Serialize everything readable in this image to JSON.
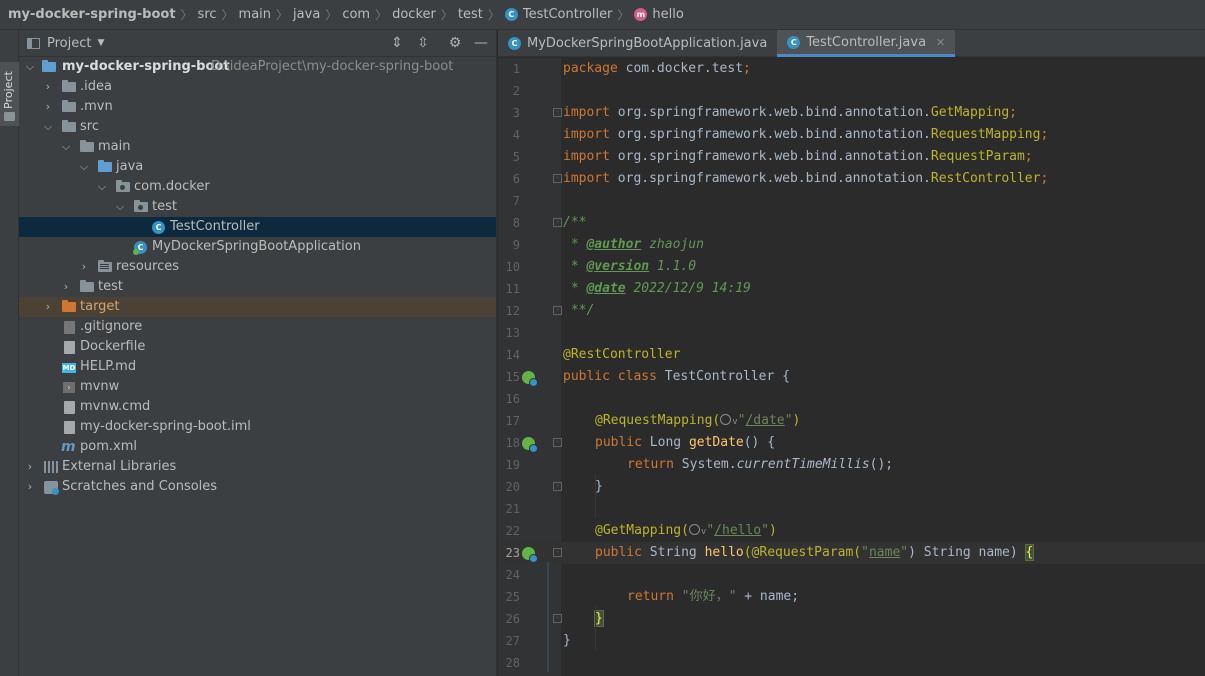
{
  "breadcrumbs": {
    "project": "my-docker-spring-boot",
    "path": [
      "src",
      "main",
      "java",
      "com",
      "docker",
      "test"
    ],
    "class_name": "TestController",
    "method_name": "hello"
  },
  "stripe": {
    "label": "Project"
  },
  "project_panel": {
    "title": "Project",
    "root_name": "my-docker-spring-boot",
    "root_path": "D:\\ideaProject\\my-docker-spring-boot",
    "tree": [
      {
        "label": ".idea"
      },
      {
        "label": ".mvn"
      },
      {
        "label": "src"
      },
      {
        "label": "main"
      },
      {
        "label": "java"
      },
      {
        "label": "com.docker"
      },
      {
        "label": "test"
      },
      {
        "label": "TestController"
      },
      {
        "label": "MyDockerSpringBootApplication"
      },
      {
        "label": "resources"
      },
      {
        "label": "test"
      },
      {
        "label": "target"
      },
      {
        "label": ".gitignore"
      },
      {
        "label": "Dockerfile"
      },
      {
        "label": "HELP.md"
      },
      {
        "label": "mvnw"
      },
      {
        "label": "mvnw.cmd"
      },
      {
        "label": "my-docker-spring-boot.iml"
      },
      {
        "label": "pom.xml"
      },
      {
        "label": "External Libraries"
      },
      {
        "label": "Scratches and Consoles"
      }
    ]
  },
  "editor": {
    "tabs": [
      {
        "label": "MyDockerSpringBootApplication.java",
        "active": false
      },
      {
        "label": "TestController.java",
        "active": true
      }
    ],
    "line_numbers": [
      "1",
      "2",
      "3",
      "4",
      "5",
      "6",
      "7",
      "8",
      "9",
      "10",
      "11",
      "12",
      "13",
      "14",
      "15",
      "16",
      "17",
      "18",
      "19",
      "20",
      "21",
      "22",
      "23",
      "24",
      "25",
      "26",
      "27",
      "28"
    ],
    "code": {
      "package_kw": "package",
      "package_name": " com.docker.test",
      "semi": ";",
      "import_kw": "import",
      "imports": [
        {
          "pkg": " org.springframework.web.bind.annotation.",
          "name": "GetMapping"
        },
        {
          "pkg": " org.springframework.web.bind.annotation.",
          "name": "RequestMapping"
        },
        {
          "pkg": " org.springframework.web.bind.annotation.",
          "name": "RequestParam"
        },
        {
          "pkg": " org.springframework.web.bind.annotation.",
          "name": "RestController"
        }
      ],
      "doc_open": "/**",
      "doc_prefix": " * ",
      "doc_tags": [
        {
          "tag": "@author",
          "value": " zhaojun"
        },
        {
          "tag": "@version",
          "value": " 1.1.0"
        },
        {
          "tag": "@date",
          "value": " 2022/12/9 14:19"
        }
      ],
      "doc_close": " **/",
      "rest_anno": "@RestController",
      "public_kw": "public",
      "class_kw": " class",
      "class_name": " TestController {",
      "req_anno": "@RequestMapping(",
      "date_path": "/date",
      "long_type": " Long ",
      "getdate_fn": "getDate",
      "getdate_rest": "() {",
      "return_kw": "return",
      "system_call": " System.",
      "ctm": "currentTimeMillis",
      "ctm_rest": "();",
      "close_brace": "}",
      "get_anno": "@GetMapping(",
      "hello_path": "/hello",
      "string_type": " String ",
      "hello_fn": "hello",
      "param_anno": "(@RequestParam(",
      "name_lit": "name",
      "param_rest": ") String name) ",
      "open_brace": "{",
      "greeting": "\"你好，\"",
      "concat": " + name;",
      "quote": "\"",
      "close_paren": ")"
    }
  }
}
